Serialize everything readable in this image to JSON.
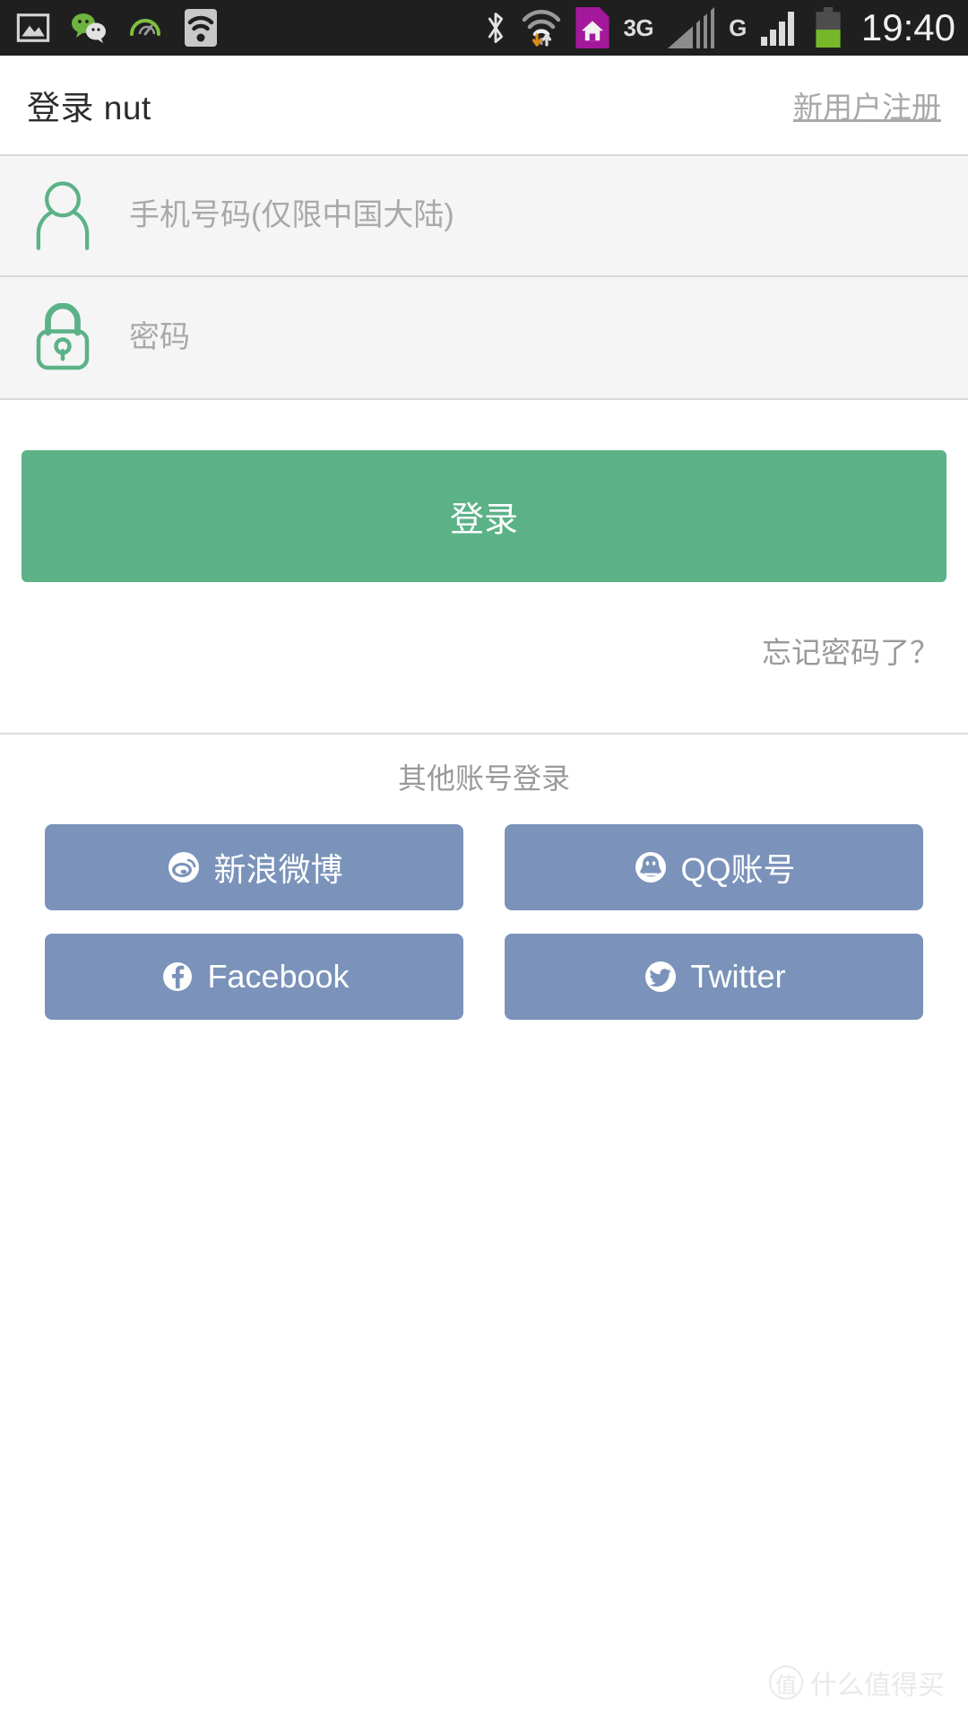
{
  "statusbar": {
    "left_icons": [
      "image-icon",
      "wechat-icon",
      "speedometer-icon",
      "wifi-hotspot-icon"
    ],
    "right_icons": [
      "bluetooth-icon",
      "wifi-transfer-icon",
      "sim-home-icon",
      "signal-bars-icon",
      "signal-bars-2-icon",
      "battery-icon"
    ],
    "network_label_1": "3G",
    "network_label_2": "G",
    "time": "19:40"
  },
  "header": {
    "title": "登录 nut",
    "register_label": "新用户注册"
  },
  "form": {
    "phone": {
      "icon": "person-icon",
      "value": "",
      "placeholder": "手机号码(仅限中国大陆)"
    },
    "password": {
      "icon": "lock-icon",
      "value": "",
      "placeholder": "密码"
    },
    "login_label": "登录",
    "forgot_label": "忘记密码了？"
  },
  "other_login": {
    "title": "其他账号登录",
    "buttons": [
      {
        "label": "新浪微博",
        "icon": "weibo-icon"
      },
      {
        "label": "QQ账号",
        "icon": "qq-icon"
      },
      {
        "label": "Facebook",
        "icon": "facebook-icon"
      },
      {
        "label": "Twitter",
        "icon": "twitter-icon"
      }
    ]
  },
  "watermark": {
    "badge": "值",
    "text": "什么值得买"
  },
  "colors": {
    "accent_green": "#5cb287",
    "social_blue": "#7b93ba",
    "statusbar_bg": "#1f1f1f",
    "field_bg": "#f5f5f5",
    "placeholder": "#a9a9a9",
    "muted_text": "#9a9a9a"
  }
}
